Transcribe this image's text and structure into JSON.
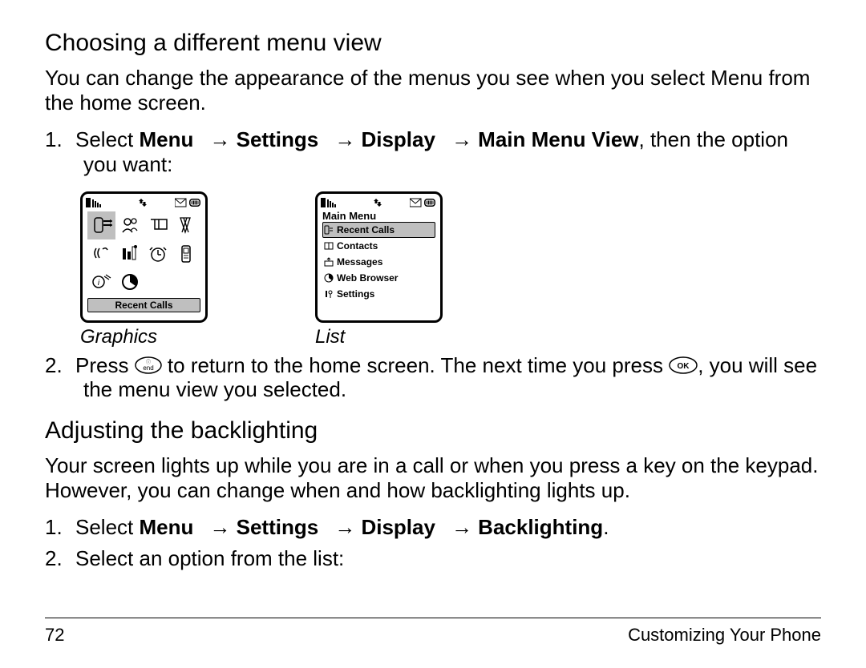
{
  "section1": {
    "title": "Choosing a different menu view",
    "intro": "You can change the appearance of the menus you see when you select Menu from the home screen.",
    "step1": {
      "num": "1.",
      "a": "Select ",
      "menu": "Menu",
      "b": "",
      "settings": "Settings",
      "c": "",
      "display": "Display",
      "d": "",
      "mmv": "Main Menu View",
      "e": ", then the option you want:"
    },
    "graphics_caption": "Graphics",
    "list_caption": "List",
    "graphics_selected_label": "Recent Calls",
    "list_title": "Main Menu",
    "list_items": [
      "Recent Calls",
      "Contacts",
      "Messages",
      "Web Browser",
      "Settings"
    ],
    "step2": {
      "num": "2.",
      "a": "Press ",
      "b": " to return to the home screen. The next time you press ",
      "c": ", you will see the menu view you selected."
    }
  },
  "section2": {
    "title": "Adjusting the backlighting",
    "intro": "Your screen lights up while you are in a call or when you press a key on the keypad. However, you can change when and how backlighting lights up.",
    "step1": {
      "num": "1.",
      "a": "Select ",
      "menu": "Menu",
      "settings": "Settings",
      "display": "Display",
      "backlighting": "Backlighting",
      "dot": "."
    },
    "step2": {
      "num": "2.",
      "text": "Select an option from the list:"
    }
  },
  "footer": {
    "page": "72",
    "chapter": "Customizing Your Phone"
  }
}
